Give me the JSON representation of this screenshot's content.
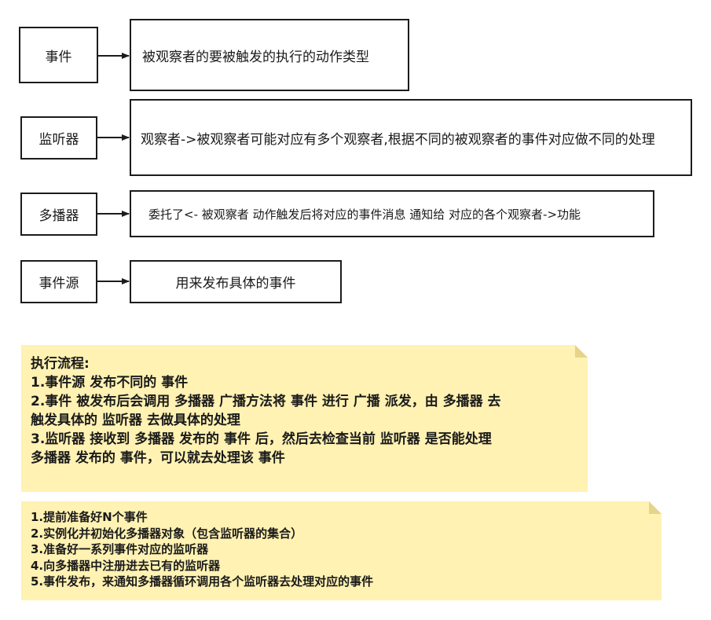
{
  "rows": [
    {
      "term": "事件",
      "desc": "被观察者的要被触发的执行的动作类型"
    },
    {
      "term": "监听器",
      "desc": "观察者->被观察者可能对应有多个观察者,根据不同的被观察者的事件对应做不同的处理"
    },
    {
      "term": "多播器",
      "desc": "委托了<- 被观察者 动作触发后将对应的事件消息 通知给 对应的各个观察者->功能"
    },
    {
      "term": "事件源",
      "desc": "用来发布具体的事件"
    }
  ],
  "note1": {
    "lines": [
      "执行流程:",
      "1.事件源 发布不同的 事件",
      "2.事件 被发布后会调用 多播器 广播方法将 事件 进行 广播 派发，由 多播器 去",
      "触发具体的 监听器 去做具体的处理",
      "3.监听器 接收到 多播器 发布的 事件 后，然后去检查当前 监听器 是否能处理",
      "多播器 发布的 事件，可以就去处理该 事件"
    ]
  },
  "note2": {
    "lines": [
      "1.提前准备好N个事件",
      "2.实例化并初始化多播器对象（包含监听器的集合）",
      "3.准备好一系列事件对应的监听器",
      "4.向多播器中注册进去已有的监听器",
      "5.事件发布，来通知多播器循环调用各个监听器去处理对应的事件"
    ]
  },
  "colors": {
    "border": "#1c1c1c",
    "note_fill": "#fff2b3",
    "note_fold": "#e5d48a"
  }
}
